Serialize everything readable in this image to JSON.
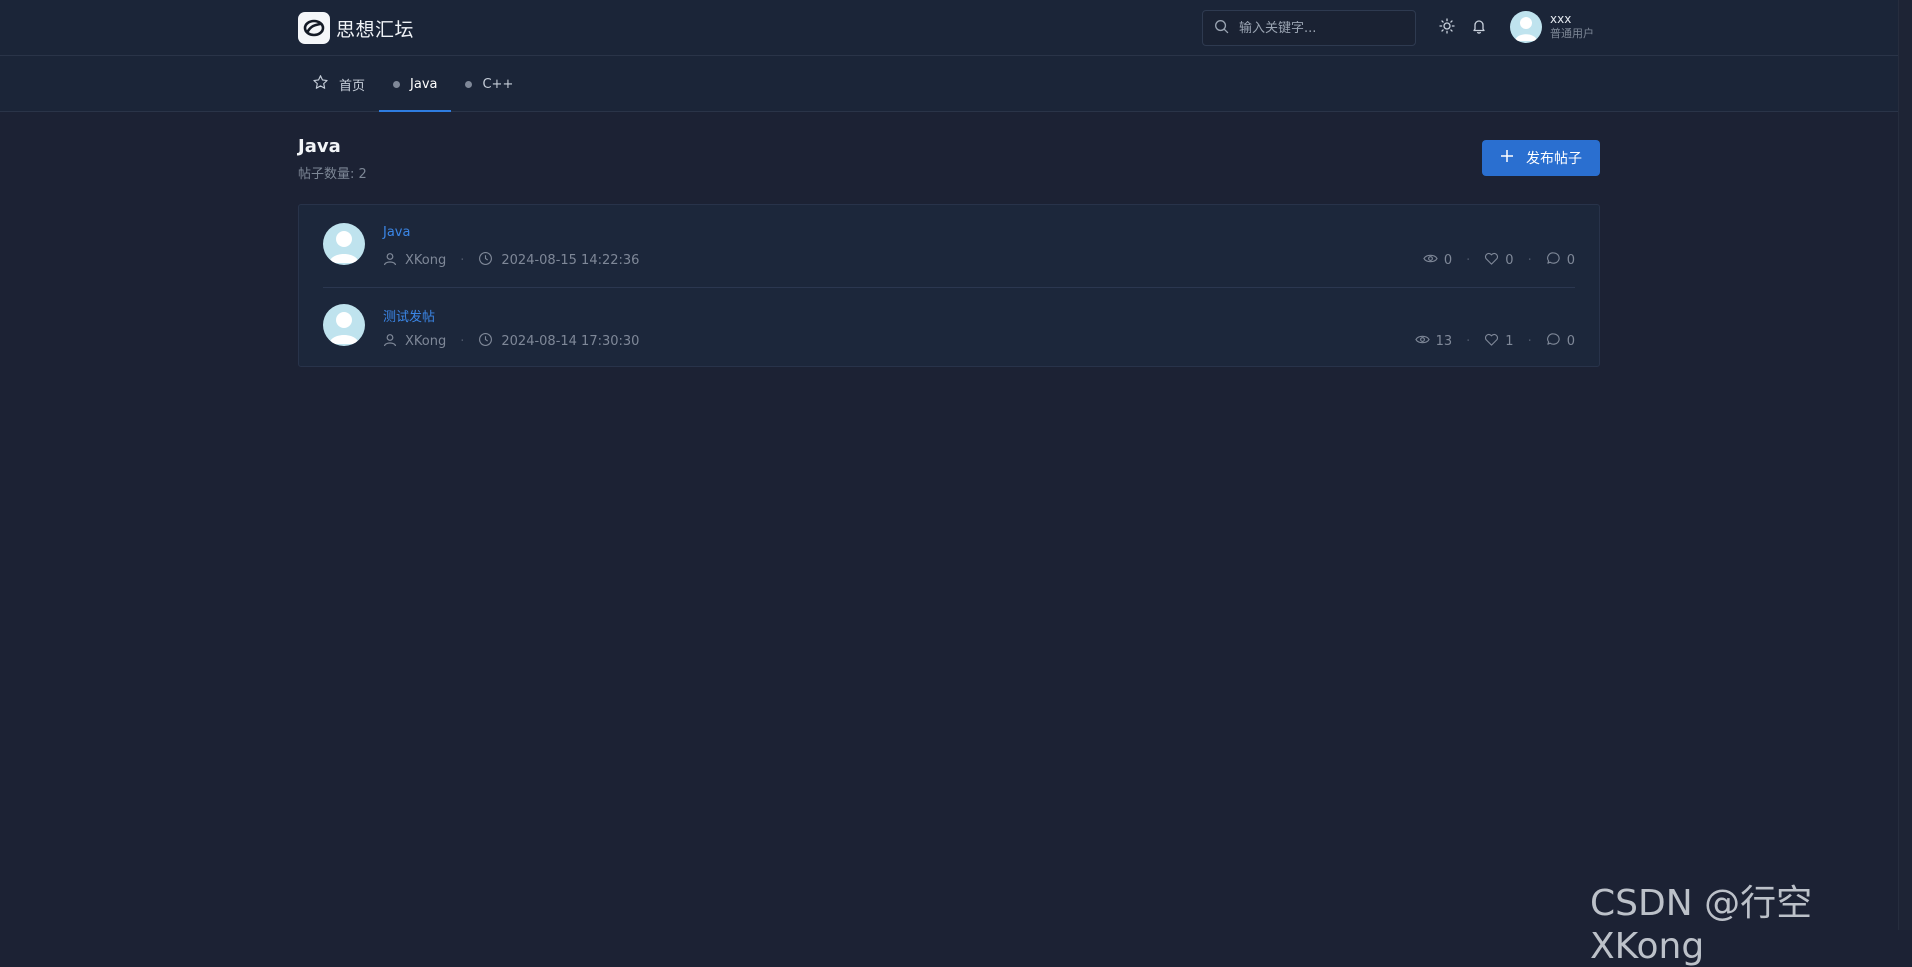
{
  "app": {
    "brand_name": "思想汇坛"
  },
  "header": {
    "search_placeholder": "输入关键字...",
    "user": {
      "name": "xxx",
      "role": "普通用户"
    }
  },
  "nav": {
    "tabs": [
      {
        "label": "首页",
        "icon": "star-icon",
        "active": false
      },
      {
        "label": "Java",
        "icon": "dot",
        "active": true
      },
      {
        "label": "C++",
        "icon": "dot",
        "active": false
      }
    ]
  },
  "page": {
    "title": "Java",
    "post_count": "帖子数量: 2",
    "publish_label": "发布帖子"
  },
  "posts": [
    {
      "title": "Java",
      "author": "XKong",
      "time": "2024-08-15 14:22:36",
      "views": "0",
      "likes": "0",
      "comments": "0"
    },
    {
      "title": "测试发帖",
      "author": "XKong",
      "time": "2024-08-14 17:30:30",
      "views": "13",
      "likes": "1",
      "comments": "0"
    }
  ],
  "watermark": "CSDN @行空XKong",
  "colors": {
    "accent": "#2a6fd0",
    "link": "#3b86e6",
    "background": "#1c2234"
  }
}
